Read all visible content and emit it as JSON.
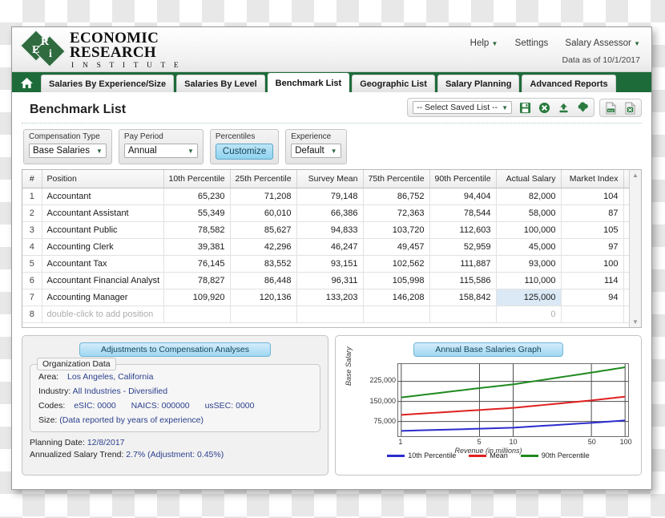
{
  "header": {
    "logo_line1": "ECONOMIC",
    "logo_line2": "RESEARCH",
    "logo_line3": "I N S T I T U T E",
    "logo_letters": {
      "e": "E",
      "r": "R",
      "i": "i"
    },
    "help_label": "Help",
    "settings_label": "Settings",
    "product_label": "Salary Assessor",
    "data_as_of": "Data as of 10/1/2017"
  },
  "nav": {
    "home_icon": "home-icon",
    "tabs": [
      {
        "label": "Salaries By Experience/Size",
        "active": false
      },
      {
        "label": "Salaries By Level",
        "active": false
      },
      {
        "label": "Benchmark List",
        "active": true
      },
      {
        "label": "Geographic List",
        "active": false
      },
      {
        "label": "Salary Planning",
        "active": false
      },
      {
        "label": "Advanced Reports",
        "active": false
      }
    ]
  },
  "page": {
    "title": "Benchmark List"
  },
  "saved_list": {
    "select_value": "-- Select Saved List --",
    "icons": [
      "save-icon",
      "delete-list-icon",
      "upload-icon",
      "download-icon"
    ],
    "export_icons": [
      "pdf-export-icon",
      "excel-export-icon"
    ],
    "pdf_label": "PDF",
    "excel_label": "XLS"
  },
  "filters": [
    {
      "label": "Compensation Type",
      "value": "Base Salaries",
      "type": "select"
    },
    {
      "label": "Pay Period",
      "value": "Annual",
      "type": "select"
    },
    {
      "label": "Percentiles",
      "value": "Customize",
      "type": "button"
    },
    {
      "label": "Experience",
      "value": "Default",
      "type": "select"
    }
  ],
  "table": {
    "columns": [
      "#",
      "Position",
      "10th Percentile",
      "25th Percentile",
      "Survey Mean",
      "75th Percentile",
      "90th Percentile",
      "Actual Salary",
      "Market Index",
      ""
    ],
    "rows": [
      {
        "n": "1",
        "position": "Accountant",
        "p10": "65,230",
        "p25": "71,208",
        "mean": "79,148",
        "p75": "86,752",
        "p90": "94,404",
        "actual": "82,000",
        "index": "104"
      },
      {
        "n": "2",
        "position": "Accountant Assistant",
        "p10": "55,349",
        "p25": "60,010",
        "mean": "66,386",
        "p75": "72,363",
        "p90": "78,544",
        "actual": "58,000",
        "index": "87"
      },
      {
        "n": "3",
        "position": "Accountant Public",
        "p10": "78,582",
        "p25": "85,627",
        "mean": "94,833",
        "p75": "103,720",
        "p90": "112,603",
        "actual": "100,000",
        "index": "105"
      },
      {
        "n": "4",
        "position": "Accounting Clerk",
        "p10": "39,381",
        "p25": "42,296",
        "mean": "46,247",
        "p75": "49,457",
        "p90": "52,959",
        "actual": "45,000",
        "index": "97"
      },
      {
        "n": "5",
        "position": "Accountant Tax",
        "p10": "76,145",
        "p25": "83,552",
        "mean": "93,151",
        "p75": "102,562",
        "p90": "111,887",
        "actual": "93,000",
        "index": "100"
      },
      {
        "n": "6",
        "position": "Accountant Financial Analyst",
        "p10": "78,827",
        "p25": "86,448",
        "mean": "96,311",
        "p75": "105,998",
        "p90": "115,586",
        "actual": "110,000",
        "index": "114"
      },
      {
        "n": "7",
        "position": "Accounting Manager",
        "p10": "109,920",
        "p25": "120,136",
        "mean": "133,203",
        "p75": "146,208",
        "p90": "158,842",
        "actual": "125,000",
        "index": "94",
        "actual_selected": true
      }
    ],
    "add_row": {
      "n": "8",
      "position": "double-click to add position",
      "p10": "",
      "p25": "",
      "mean": "",
      "p75": "",
      "p90": "",
      "actual": "0",
      "index": ""
    }
  },
  "adjustments_panel": {
    "title": "Adjustments to Compensation Analyses",
    "group_legend": "Organization Data",
    "area_label": "Area:",
    "area_value": "Los Angeles, California",
    "industry_label": "Industry:",
    "industry_value": "All Industries - Diversified",
    "codes_label": "Codes:",
    "esic_label": "eSIC:",
    "esic_value": "0000",
    "naics_label": "NAICS:",
    "naics_value": "000000",
    "ussec_label": "usSEC:",
    "ussec_value": "0000",
    "size_label": "Size:",
    "size_value": "(Data reported by years of experience)",
    "planning_date_label": "Planning Date:",
    "planning_date_value": "12/8/2017",
    "trend_label": "Annualized Salary Trend:",
    "trend_value": "2.7% (Adjustment: 0.45%)"
  },
  "chart_panel": {
    "title": "Annual Base Salaries Graph"
  },
  "chart_data": {
    "type": "line",
    "title": "Annual Base Salaries Graph",
    "xlabel": "Revenue (in millions)",
    "ylabel": "Base Salary",
    "x": [
      1,
      5,
      10,
      50,
      100
    ],
    "x_tick_labels": [
      "1",
      "5",
      "10",
      "50",
      "100"
    ],
    "x_scale": "log",
    "y_tick_labels": [
      "75,000",
      "150,000",
      "225,000"
    ],
    "y_ticks": [
      75000,
      150000,
      225000
    ],
    "ylim": [
      20000,
      290000
    ],
    "grid": true,
    "legend_position": "bottom",
    "series": [
      {
        "name": "10th Percentile",
        "color": "#2c2ccc",
        "values": [
          40000,
          48000,
          52000,
          70000,
          79000
        ]
      },
      {
        "name": "Mean",
        "color": "#e02020",
        "values": [
          100000,
          118000,
          126000,
          154000,
          168000
        ]
      },
      {
        "name": "90th Percentile",
        "color": "#1f8a1f",
        "values": [
          165000,
          200000,
          214000,
          258000,
          278000
        ]
      }
    ]
  },
  "scrollbar": {
    "up_icon": "scroll-up-arrow-icon",
    "down_icon": "scroll-down-arrow-icon"
  }
}
